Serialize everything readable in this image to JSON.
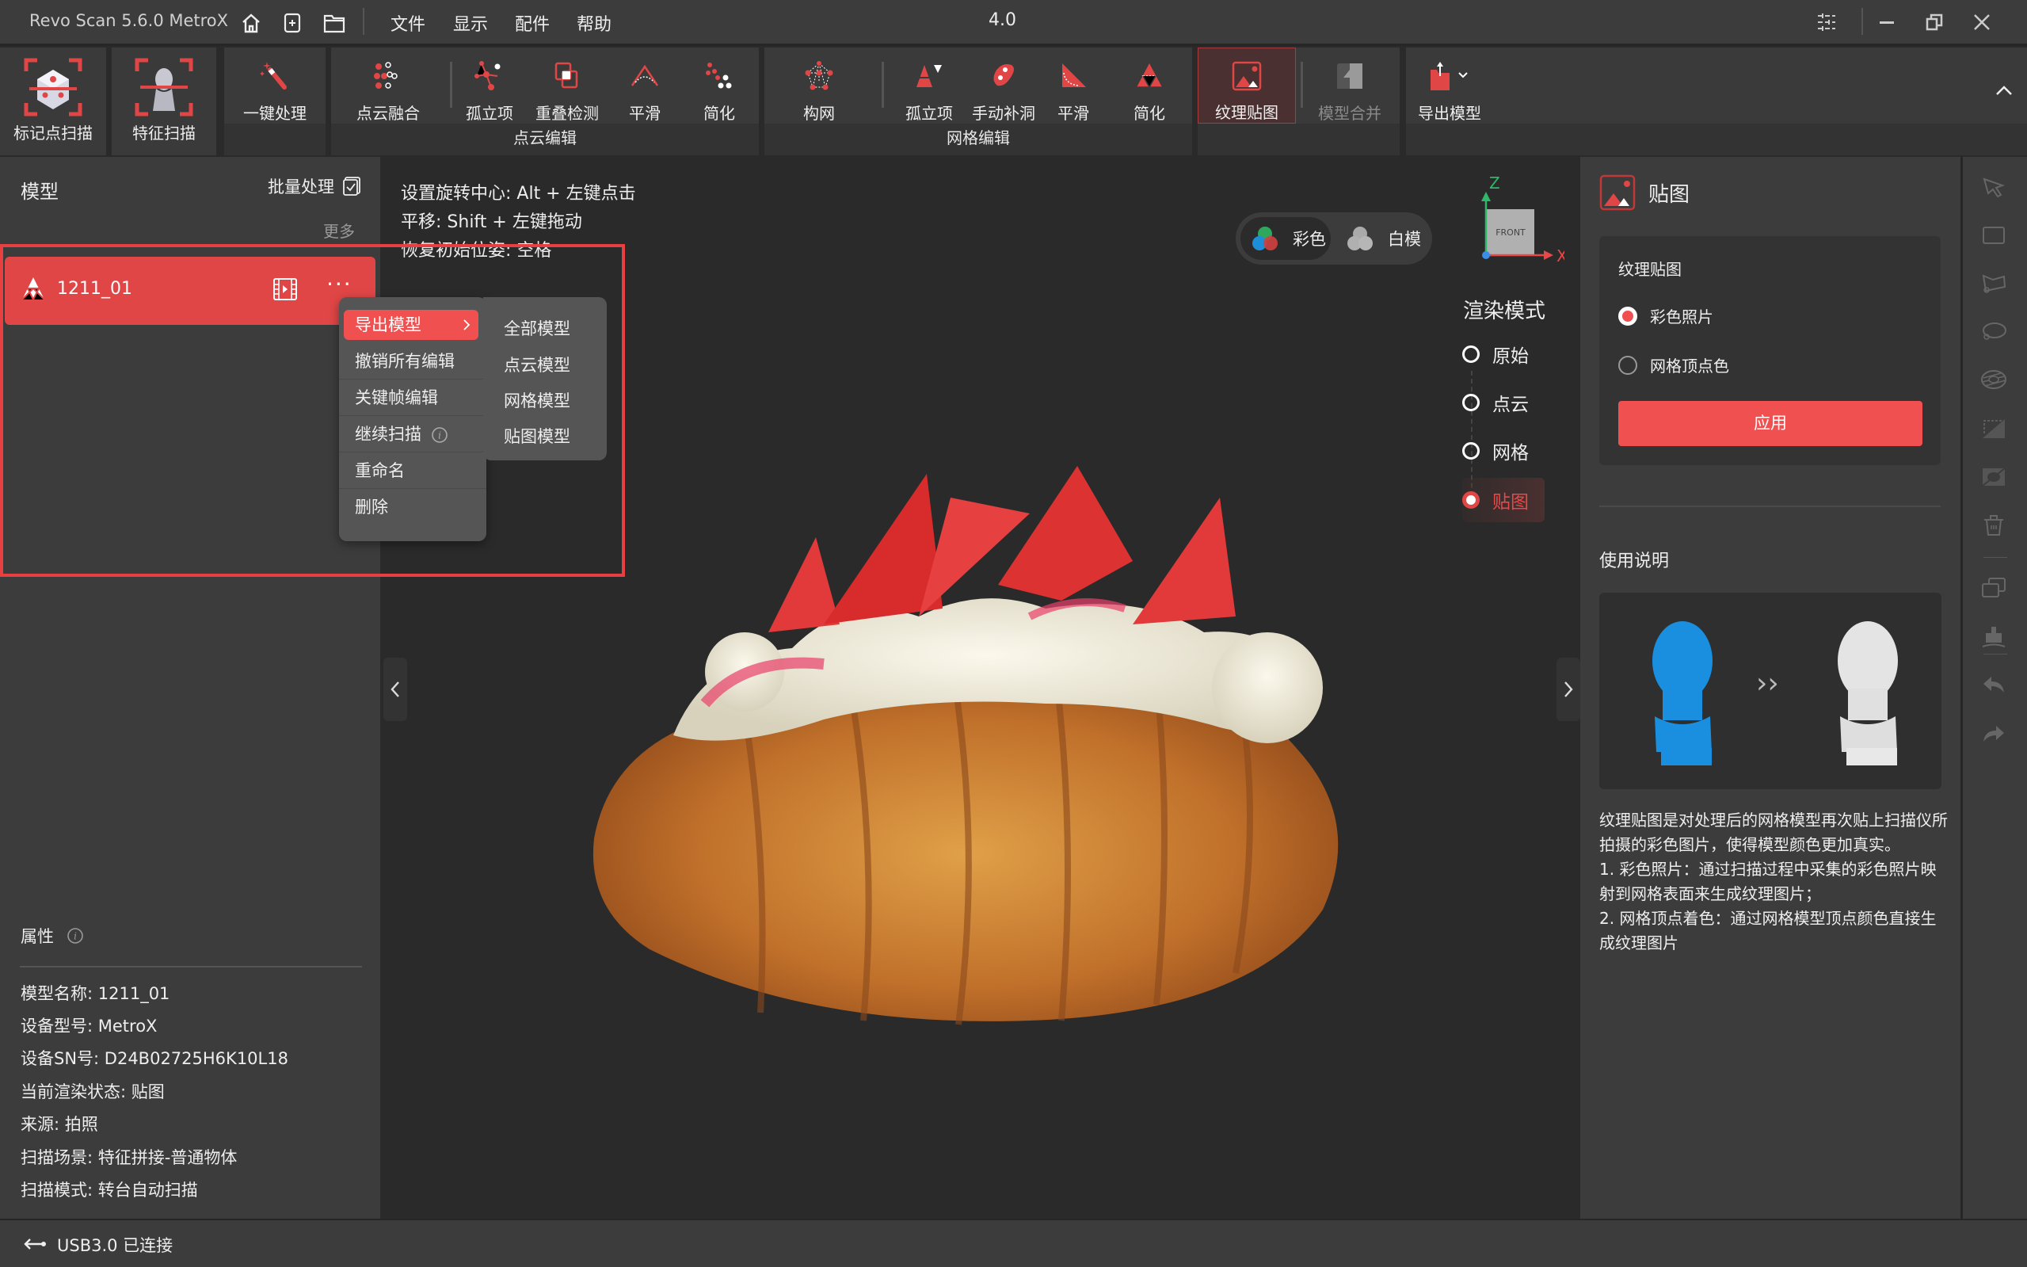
{
  "titlebar": {
    "app_title": "Revo Scan 5.6.0 MetroX",
    "menus": [
      "文件",
      "显示",
      "配件",
      "帮助"
    ],
    "version": "4.0",
    "icons": [
      "home-icon",
      "new-project-icon",
      "open-folder-icon"
    ]
  },
  "toolbar": {
    "scan_modes": [
      {
        "label": "标记点扫描",
        "icon": "marker-scan-icon"
      },
      {
        "label": "特征扫描",
        "icon": "feature-scan-icon"
      }
    ],
    "one_click": {
      "label": "一键处理",
      "icon": "magic-wand-icon"
    },
    "point_cloud_group": {
      "label": "点云编辑",
      "tools": [
        {
          "label": "点云融合",
          "icon": "point-fusion-icon"
        },
        {
          "label": "孤立项",
          "icon": "isolated-points-icon"
        },
        {
          "label": "重叠检测",
          "icon": "overlap-detect-icon"
        },
        {
          "label": "平滑",
          "icon": "smooth-icon"
        },
        {
          "label": "简化",
          "icon": "simplify-icon"
        }
      ]
    },
    "mesh_group": {
      "label": "网格编辑",
      "tools": [
        {
          "label": "构网",
          "icon": "meshing-icon"
        },
        {
          "label": "孤立项",
          "icon": "isolated-mesh-icon"
        },
        {
          "label": "手动补洞",
          "icon": "fill-hole-icon"
        },
        {
          "label": "平滑",
          "icon": "mesh-smooth-icon"
        },
        {
          "label": "简化",
          "icon": "mesh-simplify-icon"
        }
      ]
    },
    "texture": {
      "label": "纹理贴图",
      "icon": "texture-map-icon",
      "active": true
    },
    "merge": {
      "label": "模型合并",
      "icon": "merge-icon",
      "disabled": true
    },
    "export": {
      "label": "导出模型",
      "icon": "export-icon"
    }
  },
  "left_panel": {
    "title": "模型",
    "batch_label": "批量处理",
    "more_label": "更多",
    "model": {
      "name": "1211_01"
    },
    "context_menu": {
      "items": [
        "导出模型",
        "撤销所有编辑",
        "关键帧编辑",
        "继续扫描",
        "重命名",
        "删除"
      ],
      "highlighted": "导出模型",
      "submenu": [
        "全部模型",
        "点云模型",
        "网格模型",
        "贴图模型"
      ]
    },
    "properties": {
      "title": "属性",
      "rows": [
        "模型名称:  1211_01",
        "设备型号:  MetroX",
        "设备SN号:  D24B02725H6K10L18",
        "当前渲染状态:  贴图",
        "来源:  拍照",
        "扫描场景:  特征拼接-普通物体",
        "扫描模式:  转台自动扫描"
      ]
    }
  },
  "viewport": {
    "hints": [
      "设置旋转中心: Alt + 左键点击",
      "平移: Shift + 左键拖动",
      "恢复初始位姿: 空格"
    ],
    "color_toggle": {
      "options": [
        "彩色",
        "白模"
      ],
      "selected": "彩色"
    },
    "gizmo": {
      "face": "FRONT",
      "x": "X",
      "z": "Z"
    },
    "render_mode": {
      "title": "渲染模式",
      "options": [
        "原始",
        "点云",
        "网格",
        "贴图"
      ],
      "selected": "贴图"
    }
  },
  "right_panel": {
    "title": "贴图",
    "card_title": "纹理贴图",
    "options": [
      "彩色照片",
      "网格顶点色"
    ],
    "selected": "彩色照片",
    "apply_label": "应用",
    "howto_title": "使用说明",
    "description": "纹理贴图是对处理后的网格模型再次贴上扫描仪所拍摄的彩色图片，使得模型颜色更加真实。\n1. 彩色照片：通过扫描过程中采集的彩色照片映射到网格表面来生成纹理图片；\n2. 网格顶点着色：通过网格模型顶点颜色直接生成纹理图片"
  },
  "right_strip": {
    "tools": [
      "select-icon",
      "rect-select-icon",
      "polygon-select-icon",
      "lasso-select-icon",
      "select-through-icon",
      "plane-cut-icon",
      "invert-select-icon",
      "delete-icon",
      "copy-icon",
      "brush-icon",
      "undo-icon",
      "redo-icon"
    ]
  },
  "statusbar": {
    "text": "USB3.0 已连接"
  },
  "colors": {
    "accent": "#e04646",
    "button": "#f05050",
    "panel": "#3c3c3c",
    "viewport": "#2a2a2a"
  }
}
